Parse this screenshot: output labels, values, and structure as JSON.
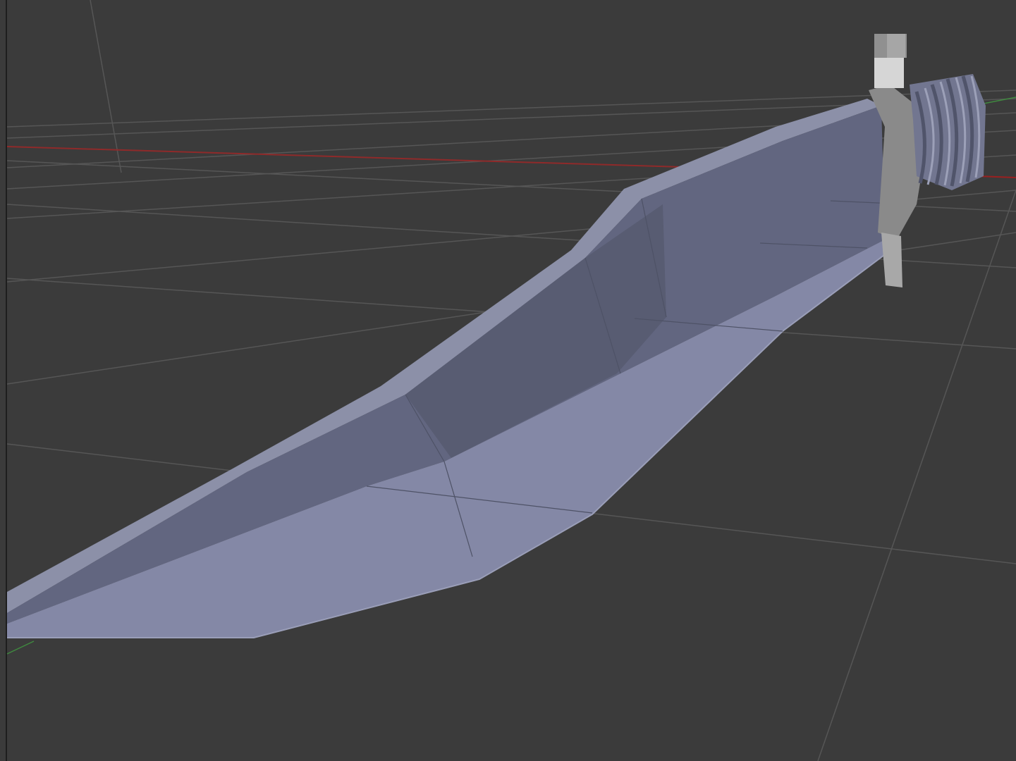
{
  "viewport": {
    "mode": "3d-viewport",
    "shading": "solid",
    "grid": true,
    "colors": {
      "background": "#3b3b3b",
      "grid_line": "#5a5a5a",
      "x_axis": "#9a2a2a",
      "y_axis": "#3f8a3f",
      "z_axis": "#5a5a5a",
      "blade_light": "#8a90ae",
      "blade_mid": "#6e738e",
      "blade_dark": "#5a5e74",
      "blade_edge": "#a0a4bc",
      "guard": "#8c8c8c",
      "handle": "#7a7e92",
      "pommel": "#d8d8d8"
    }
  },
  "object": {
    "name_icon": "knife-mesh"
  }
}
